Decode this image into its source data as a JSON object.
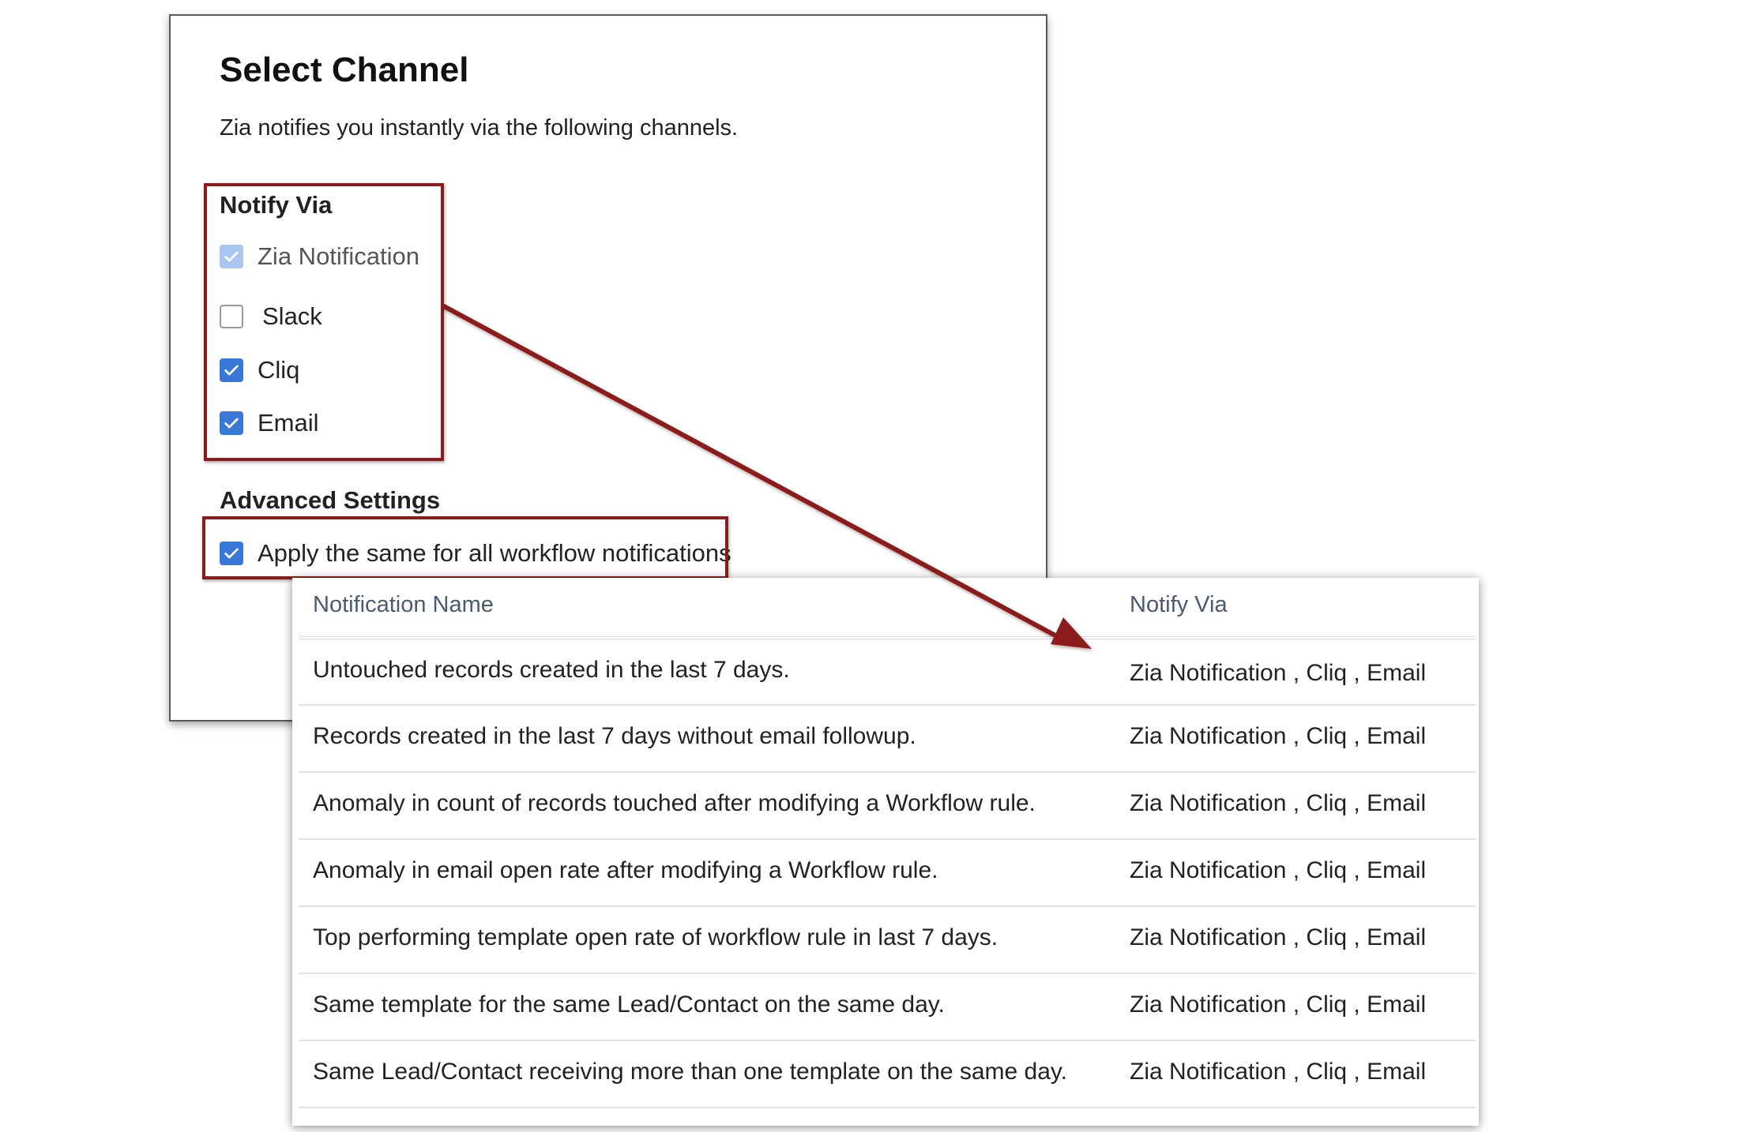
{
  "dialog": {
    "title": "Select Channel",
    "subtitle": "Zia notifies you instantly via the following channels.",
    "notify_via_label": "Notify Via",
    "channels": [
      {
        "label": "Zia Notification",
        "checked": true,
        "disabled": true
      },
      {
        "label": "Slack",
        "checked": false,
        "disabled": false
      },
      {
        "label": "Cliq",
        "checked": true,
        "disabled": false
      },
      {
        "label": "Email",
        "checked": true,
        "disabled": false
      }
    ],
    "advanced_label": "Advanced Settings",
    "apply_all": {
      "label": "Apply the same for all workflow notifications",
      "checked": true
    }
  },
  "table": {
    "headers": {
      "name": "Notification Name",
      "via": "Notify Via"
    },
    "rows": [
      {
        "name": "Untouched records created in the last 7 days.",
        "via": "Zia Notification , Cliq , Email"
      },
      {
        "name": "Records created in the last 7 days without email followup.",
        "via": "Zia Notification , Cliq , Email"
      },
      {
        "name": "Anomaly in count of records touched after modifying a Workflow rule.",
        "via": "Zia Notification , Cliq , Email"
      },
      {
        "name": "Anomaly in email open rate after modifying a Workflow rule.",
        "via": "Zia Notification , Cliq , Email"
      },
      {
        "name": "Top performing template open rate of workflow rule in last 7 days.",
        "via": "Zia Notification , Cliq , Email"
      },
      {
        "name": "Same template for the same Lead/Contact on the same day.",
        "via": "Zia Notification , Cliq , Email"
      },
      {
        "name": "Same Lead/Contact receiving more than one template on the same day.",
        "via": "Zia Notification , Cliq , Email"
      }
    ]
  },
  "colors": {
    "checkbox_checked": "#3a78d8",
    "checkbox_disabled": "#a8c6ef",
    "annotation": "#8b1c1c",
    "header_text": "#4a5a73"
  },
  "icons": {
    "checkbox_check": "check-icon",
    "annotation_arrow": "arrow-icon"
  }
}
